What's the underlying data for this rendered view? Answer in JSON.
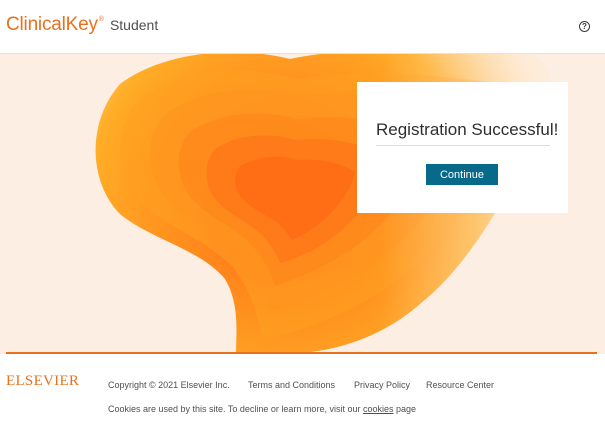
{
  "header": {
    "logo_main": "ClinicalKey",
    "logo_reg": "®",
    "logo_sub": "Student",
    "help_symbol": "?"
  },
  "card": {
    "title": "Registration Successful!",
    "button_label": "Continue"
  },
  "footer": {
    "brand": "ELSEVIER",
    "copyright": "Copyright © 2021 Elsevier Inc.",
    "links": {
      "terms": "Terms and Conditions",
      "privacy": "Privacy Policy",
      "resource": "Resource Center"
    },
    "cookies_prefix": "Cookies are used by this site. To decline or learn more, visit our",
    "cookies_link": "cookies",
    "cookies_suffix": "page"
  },
  "colors": {
    "brand_orange": "#e9711c",
    "button_teal": "#076a8a",
    "hero_background": "#fdeee4"
  },
  "icons": {
    "help": "question-circle-icon"
  }
}
